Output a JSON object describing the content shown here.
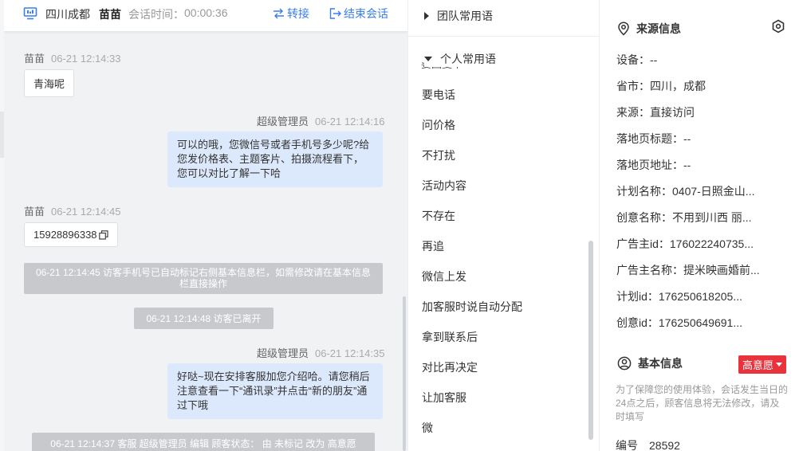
{
  "chat": {
    "header": {
      "location": "四川成都",
      "visitor": "苗苗",
      "time_label": "会话时间：",
      "time": "00:00:36",
      "transfer": "转接",
      "end": "结束会话"
    },
    "messages": [
      {
        "sender": "苗苗",
        "time": "06-21 12:14:33",
        "text": "青海呢"
      },
      {
        "sender": "超级管理员",
        "time": "06-21 12:14:16",
        "text": "可以的哦，您微信号或者手机号多少呢?给您发价格表、主题客片、拍摄流程看下，您可以对比了解一下哈"
      },
      {
        "sender": "苗苗",
        "time": "06-21 12:14:45",
        "text": "15928896338"
      },
      {
        "sender": "超级管理员",
        "time": "06-21 12:14:35",
        "text": "好哒~现在安排客服加您介绍哈。请您稍后注意查看一下“通讯录”并点击“新的朋友”通过下哦"
      }
    ],
    "system": [
      "06-21 12:14:45 访客手机号已自动标记右侧基本信息栏，如需修改请在基本信息栏直接操作",
      "06-21 12:14:48 访客已离开",
      "06-21 12:14:37 客服 超级管理员 编辑 顾客状态： 由 未标记 改为 高意愿"
    ]
  },
  "phrases": {
    "team_group": "团队常用语",
    "personal_group": "个人常用语",
    "clipped_item": "要回复个",
    "items": [
      "要电话",
      "问价格",
      "不打扰",
      "活动内容",
      "不存在",
      "再追",
      "微信上发",
      "加客服时说自动分配",
      "拿到联系后",
      "对比再决定",
      "让加客服",
      "微"
    ]
  },
  "info": {
    "source_title": "来源信息",
    "source_rows": [
      "设备：--",
      "省市：四川，成都",
      "来源：直接访问",
      "落地页标题：--",
      "落地页地址：--",
      "计划名称：0407-日照金山...",
      "创意名称：不用到川西 丽...",
      "广告主id：176022240735...",
      "广告主名称：提米映画婚前...",
      "计划id：176250618205...",
      "创意id：176250649691..."
    ],
    "basic_title": "基本信息",
    "intent_badge": "高意愿",
    "note": "为了保障您的使用体验，会话发生当日的24点之后，顾客信息将无法修改，请及时填写",
    "number_label": "编号",
    "number_value": "28592"
  },
  "colors": {
    "accent": "#3a7ee8",
    "bubble_right": "#dce9fc",
    "system_bg": "#c7c9cc",
    "badge": "#e8323c"
  }
}
